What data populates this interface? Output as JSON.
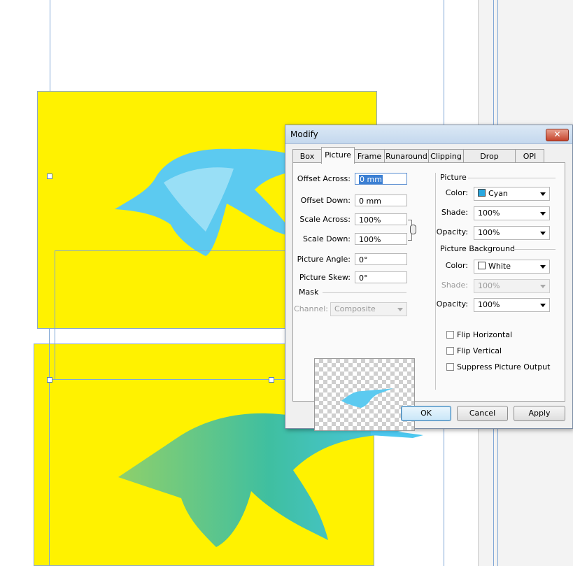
{
  "dialog": {
    "title": "Modify",
    "close_glyph": "✕",
    "tabs": [
      "Box",
      "Picture",
      "Frame",
      "Runaround",
      "Clipping",
      "Drop Shadow",
      "OPI"
    ],
    "active_tab": "Picture"
  },
  "offsets": {
    "offset_across_label": "Offset Across:",
    "offset_across_value": "0 mm",
    "offset_down_label": "Offset Down:",
    "offset_down_value": "0 mm",
    "scale_across_label": "Scale Across:",
    "scale_across_value": "100%",
    "scale_down_label": "Scale Down:",
    "scale_down_value": "100%",
    "picture_angle_label": "Picture Angle:",
    "picture_angle_value": "0°",
    "picture_skew_label": "Picture Skew:",
    "picture_skew_value": "0°"
  },
  "mask": {
    "heading": "Mask",
    "channel_label": "Channel:",
    "channel_value": "Composite"
  },
  "picture": {
    "heading": "Picture",
    "color_label": "Color:",
    "color_value": "Cyan",
    "color_swatch": "#29a8e0",
    "shade_label": "Shade:",
    "shade_value": "100%",
    "opacity_label": "Opacity:",
    "opacity_value": "100%"
  },
  "background": {
    "heading": "Picture Background",
    "color_label": "Color:",
    "color_value": "White",
    "color_swatch": "#ffffff",
    "shade_label": "Shade:",
    "shade_value": "100%",
    "opacity_label": "Opacity:",
    "opacity_value": "100%"
  },
  "options": {
    "flip_horizontal": "Flip Horizontal",
    "flip_vertical": "Flip Vertical",
    "suppress_output": "Suppress Picture Output"
  },
  "buttons": {
    "ok": "OK",
    "cancel": "Cancel",
    "apply": "Apply"
  },
  "colors": {
    "page_yellow": "#fff200",
    "cyan_bird": "#4cc8f0",
    "green_bird": "#3fbfa0",
    "guide_blue": "#7fa6d6"
  }
}
